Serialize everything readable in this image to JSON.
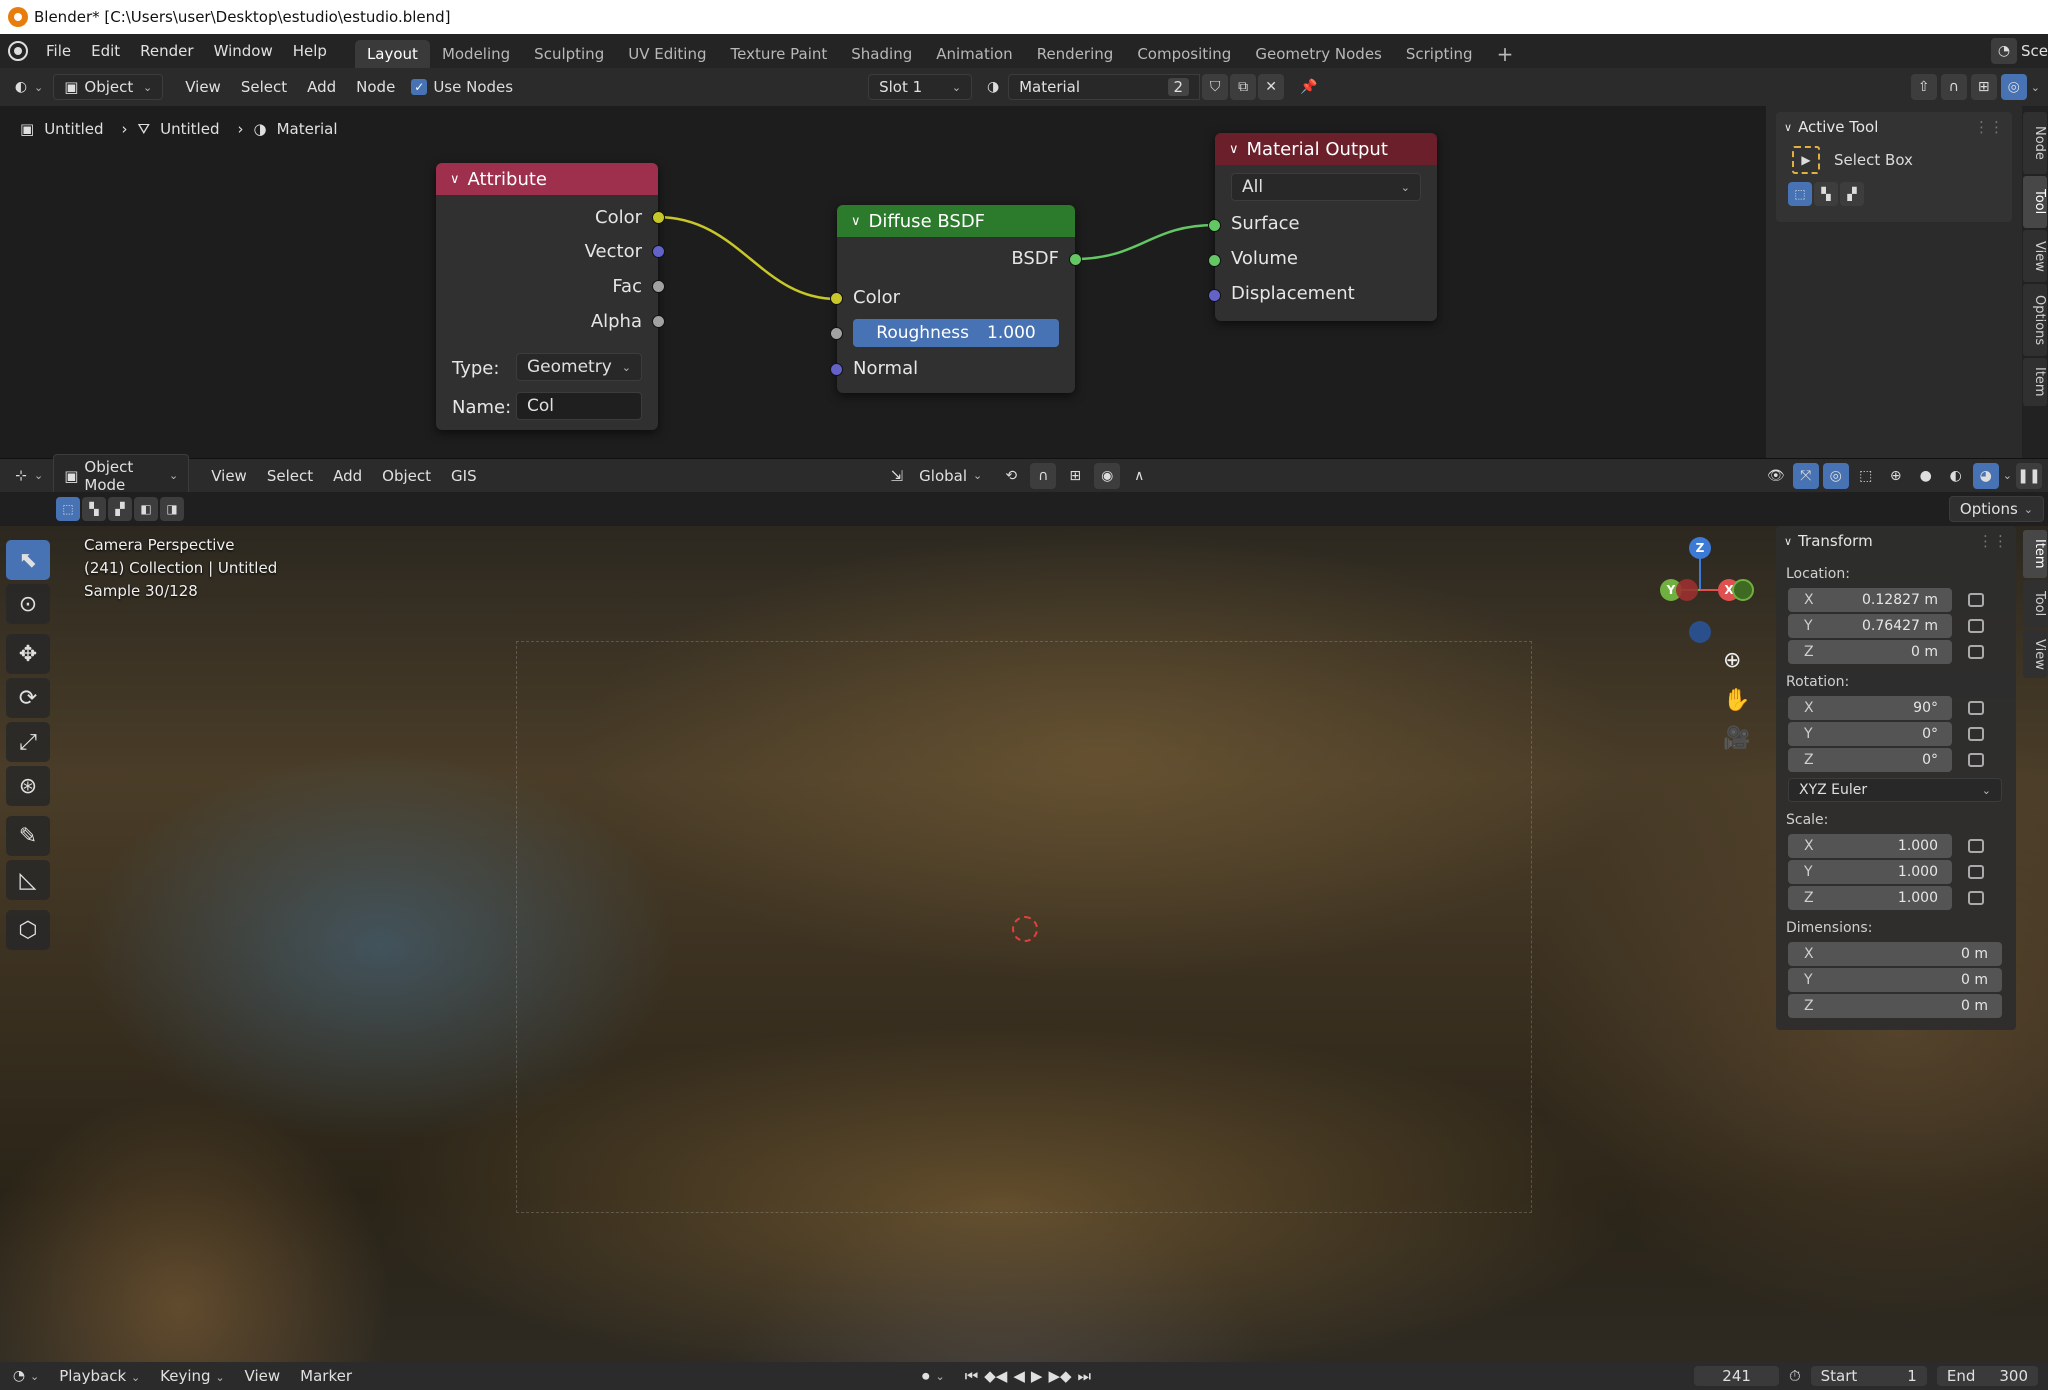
{
  "window": {
    "title": "Blender* [C:\\Users\\user\\Desktop\\estudio\\estudio.blend]"
  },
  "menu": {
    "items": [
      "File",
      "Edit",
      "Render",
      "Window",
      "Help"
    ],
    "workspaces": [
      "Layout",
      "Modeling",
      "Sculpting",
      "UV Editing",
      "Texture Paint",
      "Shading",
      "Animation",
      "Rendering",
      "Compositing",
      "Geometry Nodes",
      "Scripting"
    ],
    "active_workspace": "Layout",
    "scene_label": "Sce"
  },
  "node_header": {
    "object_dropdown": "Object",
    "menus": [
      "View",
      "Select",
      "Add",
      "Node"
    ],
    "use_nodes_label": "Use Nodes",
    "slot": "Slot 1",
    "material_name": "Material",
    "user_count": "2"
  },
  "breadcrumb": [
    "Untitled",
    "Untitled",
    "Material"
  ],
  "nodes": {
    "attribute": {
      "title": "Attribute",
      "outputs": [
        "Color",
        "Vector",
        "Fac",
        "Alpha"
      ],
      "type_label": "Type:",
      "type_value": "Geometry",
      "name_label": "Name:",
      "name_value": "Col",
      "color": "#9e2f4d"
    },
    "diffuse": {
      "title": "Diffuse BSDF",
      "output": "BSDF",
      "inputs": [
        "Color",
        "Normal"
      ],
      "roughness_label": "Roughness",
      "roughness_value": "1.000",
      "color": "#2c7a2c"
    },
    "output": {
      "title": "Material Output",
      "target": "All",
      "inputs": [
        "Surface",
        "Volume",
        "Displacement"
      ],
      "color": "#6a1f2a"
    }
  },
  "node_sidebar": {
    "section": "Active Tool",
    "tool_name": "Select Box",
    "tabs": [
      "Node",
      "Tool",
      "View",
      "Options",
      "Item"
    ],
    "active_tab": "Tool"
  },
  "viewport_header": {
    "mode": "Object Mode",
    "menus": [
      "View",
      "Select",
      "Add",
      "Object",
      "GIS"
    ],
    "orientation": "Global",
    "options_label": "Options"
  },
  "viewport": {
    "overlay_lines": [
      "Camera Perspective",
      "(241) Collection | Untitled",
      "Sample 30/128"
    ]
  },
  "transform": {
    "title": "Transform",
    "location_label": "Location:",
    "location": [
      [
        "X",
        "0.12827 m"
      ],
      [
        "Y",
        "0.76427 m"
      ],
      [
        "Z",
        "0 m"
      ]
    ],
    "rotation_label": "Rotation:",
    "rotation": [
      [
        "X",
        "90°"
      ],
      [
        "Y",
        "0°"
      ],
      [
        "Z",
        "0°"
      ]
    ],
    "rotation_mode": "XYZ Euler",
    "scale_label": "Scale:",
    "scale": [
      [
        "X",
        "1.000"
      ],
      [
        "Y",
        "1.000"
      ],
      [
        "Z",
        "1.000"
      ]
    ],
    "dimensions_label": "Dimensions:",
    "dimensions": [
      [
        "X",
        "0 m"
      ],
      [
        "Y",
        "0 m"
      ],
      [
        "Z",
        "0 m"
      ]
    ],
    "tabs": [
      "Item",
      "Tool",
      "View"
    ],
    "active_tab": "Item"
  },
  "timeline": {
    "menus": [
      "Playback",
      "Keying",
      "View",
      "Marker"
    ],
    "current_frame": "241",
    "start_label": "Start",
    "start": "1",
    "end_label": "End",
    "end": "300"
  }
}
